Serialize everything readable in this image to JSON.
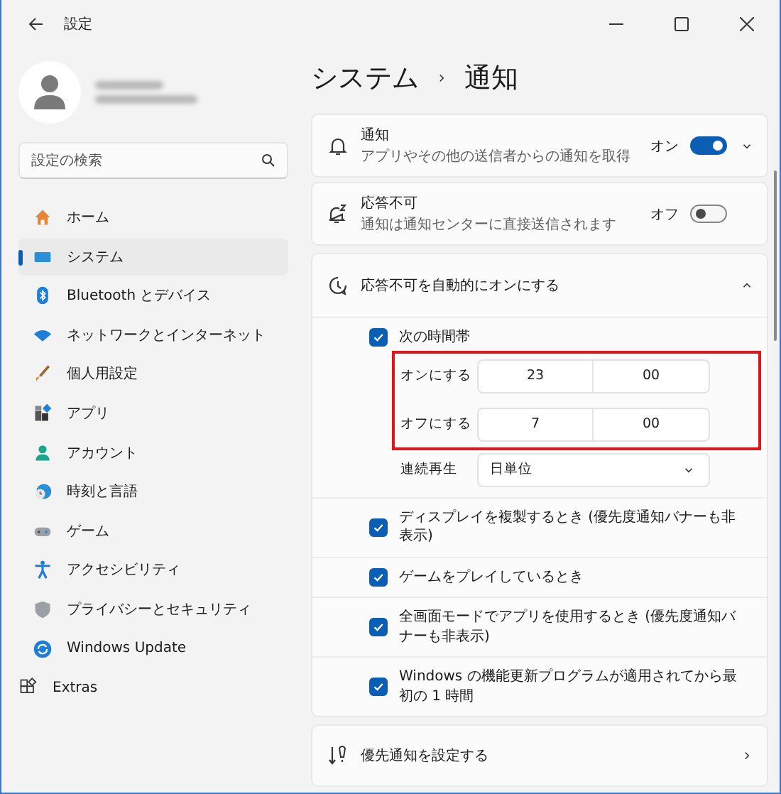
{
  "window": {
    "title": "設定"
  },
  "sidebar": {
    "search": {
      "placeholder": "設定の検索"
    },
    "items": [
      {
        "label": "ホーム",
        "selected": false
      },
      {
        "label": "システム",
        "selected": true
      },
      {
        "label": "Bluetooth とデバイス",
        "selected": false
      },
      {
        "label": "ネットワークとインターネット",
        "selected": false
      },
      {
        "label": "個人用設定",
        "selected": false
      },
      {
        "label": "アプリ",
        "selected": false
      },
      {
        "label": "アカウント",
        "selected": false
      },
      {
        "label": "時刻と言語",
        "selected": false
      },
      {
        "label": "ゲーム",
        "selected": false
      },
      {
        "label": "アクセシビリティ",
        "selected": false
      },
      {
        "label": "プライバシーとセキュリティ",
        "selected": false
      },
      {
        "label": "Windows Update",
        "selected": false
      },
      {
        "label": "Extras",
        "selected": false
      }
    ]
  },
  "breadcrumb": [
    "システム",
    "通知"
  ],
  "toggle_cards": [
    {
      "kind": "expandable",
      "title": "通知",
      "subtitle": "アプリやその他の送信者からの通知を取得",
      "state_label": "オン",
      "on": true
    },
    {
      "kind": "plain",
      "title": "応答不可",
      "subtitle": "通知は通知センターに直接送信されます",
      "state_label": "オフ",
      "on": false
    }
  ],
  "auto_dnd": {
    "title": "応答不可を自動的にオンにする",
    "expanded": true,
    "time_range": {
      "label": "次の時間帯",
      "checked": true,
      "highlighted": true,
      "rows": [
        {
          "label": "オンにする",
          "hour": "23",
          "minute": "00"
        },
        {
          "label": "オフにする",
          "hour": "7",
          "minute": "00"
        }
      ]
    },
    "repeat": {
      "label": "連続再生",
      "value": "日単位"
    },
    "conditions": [
      {
        "label": "ディスプレイを複製するとき (優先度通知バナーも非表示)",
        "checked": true
      },
      {
        "label": "ゲームをプレイしているとき",
        "checked": true
      },
      {
        "label": "全画面モードでアプリを使用するとき (優先度通知バナーも非表示)",
        "checked": true
      },
      {
        "label": "Windows の機能更新プログラムが適用されてから最初の 1 時間",
        "checked": true
      }
    ]
  },
  "priority": {
    "title": "優先通知を設定する"
  }
}
